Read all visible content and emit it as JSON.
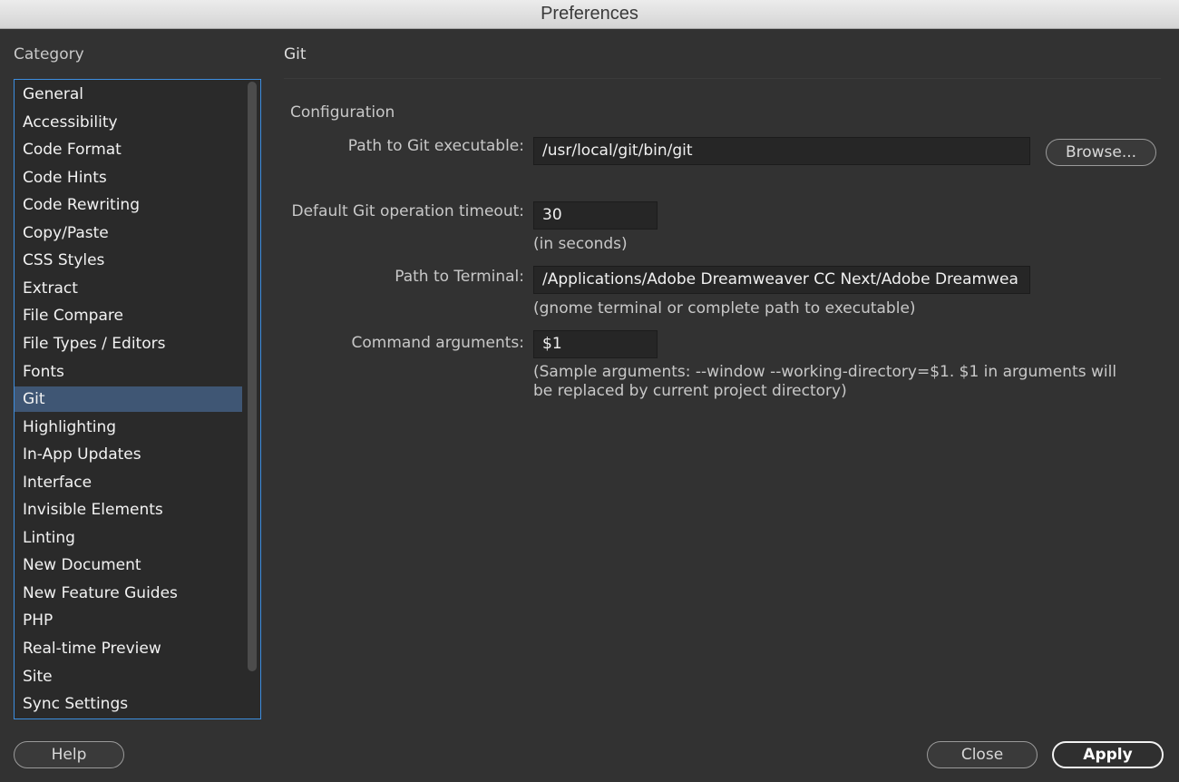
{
  "window": {
    "title": "Preferences"
  },
  "sidebar": {
    "heading": "Category",
    "selected_index": 11,
    "items": [
      "General",
      "Accessibility",
      "Code Format",
      "Code Hints",
      "Code Rewriting",
      "Copy/Paste",
      "CSS Styles",
      "Extract",
      "File Compare",
      "File Types / Editors",
      "Fonts",
      "Git",
      "Highlighting",
      "In-App Updates",
      "Interface",
      "Invisible Elements",
      "Linting",
      "New Document",
      "New Feature Guides",
      "PHP",
      "Real-time Preview",
      "Site",
      "Sync Settings"
    ]
  },
  "panel": {
    "title": "Git",
    "group_label": "Configuration",
    "git_path": {
      "label": "Path to Git executable:",
      "value": "/usr/local/git/bin/git",
      "browse_label": "Browse..."
    },
    "timeout": {
      "label": "Default Git operation timeout:",
      "value": "30",
      "hint": "(in seconds)"
    },
    "terminal": {
      "label": "Path to Terminal:",
      "value": "/Applications/Adobe Dreamweaver CC Next/Adobe Dreamwea",
      "hint": "(gnome terminal or complete path to executable)"
    },
    "arguments": {
      "label": "Command arguments:",
      "value": "$1",
      "hint_line1": "(Sample arguments: --window --working-directory=$1. $1 in arguments will",
      "hint_line2": "be replaced by current project directory)"
    }
  },
  "footer": {
    "help_label": "Help",
    "close_label": "Close",
    "apply_label": "Apply"
  },
  "colors": {
    "background": "#323232",
    "selection": "#3f5674",
    "focus_border": "#3d8ee0"
  }
}
